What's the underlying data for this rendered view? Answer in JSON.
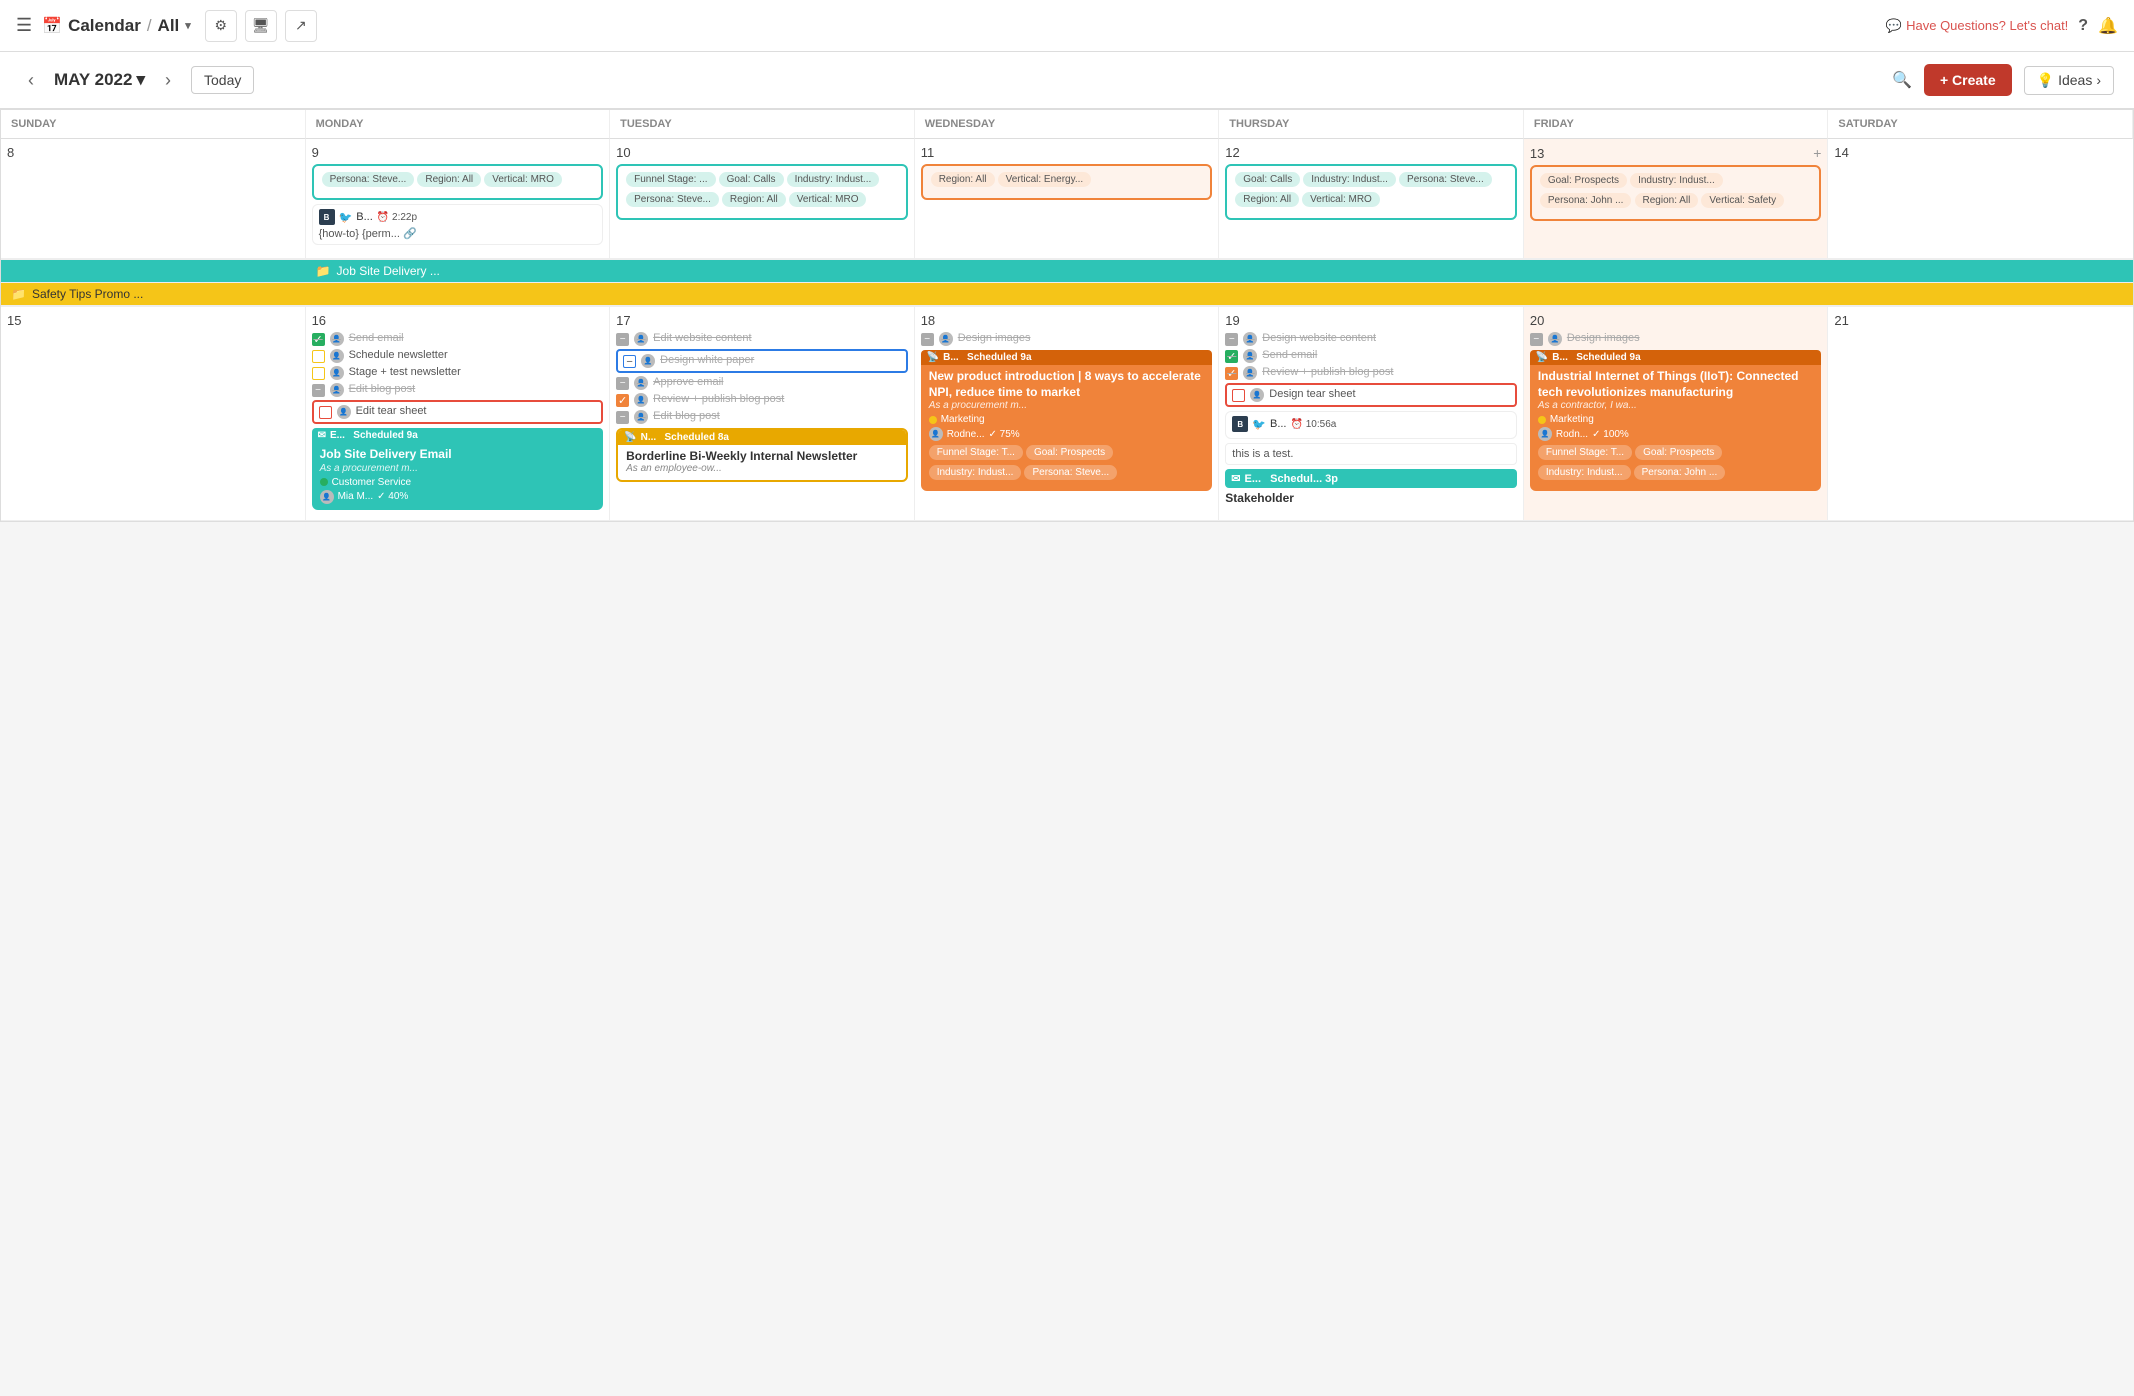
{
  "topNav": {
    "title": "Calendar",
    "separator": "/",
    "view": "All",
    "chatText": "Have Questions? Let's chat!",
    "ideasLabel": "Ideas"
  },
  "calHeader": {
    "prevArrow": "‹",
    "nextArrow": "›",
    "monthTitle": "MAY 2022",
    "todayLabel": "Today",
    "createLabel": "+ Create",
    "ideasLabel": "Ideas"
  },
  "dayHeaders": [
    "SUNDAY",
    "MONDAY",
    "TUESDAY",
    "WEDNESDAY",
    "THURSDAY",
    "FRIDAY",
    "SATURDAY"
  ],
  "week1": {
    "days": [
      8,
      9,
      10,
      11,
      12,
      13,
      14
    ],
    "spanEvent1": "Job Site Delivery ...",
    "spanEvent2": "Safety Tips Promo ..."
  },
  "week2": {
    "days": [
      15,
      16,
      17,
      18,
      19,
      20,
      21
    ]
  },
  "colors": {
    "teal": "#2ec4b6",
    "orange": "#f0833a",
    "red": "#e74c3c",
    "yellow": "#f5c518",
    "green": "#27ae60"
  }
}
